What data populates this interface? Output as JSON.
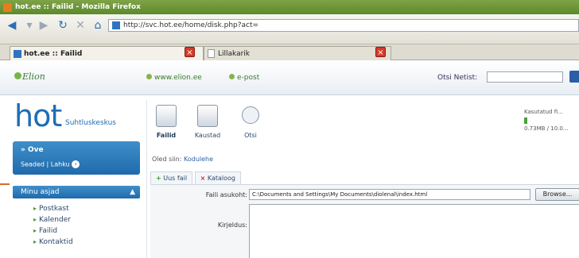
{
  "window": {
    "title": "hot.ee :: Failid - Mozilla Firefox"
  },
  "address_bar": {
    "url": "http://svc.hot.ee/home/disk.php?act="
  },
  "tabs": [
    {
      "label": "hot.ee :: Failid"
    },
    {
      "label": "Lillakarik"
    }
  ],
  "site_header": {
    "logo": "Elion",
    "links": [
      "www.elion.ee",
      "e-post"
    ],
    "search_label": "Otsi Netist:"
  },
  "sidebar": {
    "logo": "hot",
    "logo_sub": "Suhtluskeskus",
    "user_name": "Ove",
    "user_links": "Seaded | Lahku",
    "menu_title": "Minu asjad",
    "menu_items": [
      "Postkast",
      "Kalender",
      "Failid",
      "Kontaktid"
    ]
  },
  "toolbar": {
    "items": [
      "Failid",
      "Kaustad",
      "Otsi"
    ],
    "usage_line1": "Kasutatud fi...",
    "usage_line2": "0.73MB / 10.0..."
  },
  "breadcrumb": {
    "prefix": "Oled siin:",
    "current": "Kodulehe"
  },
  "subtabs": {
    "add_file": "Uus fail",
    "delete_folder": "Kataloog"
  },
  "form": {
    "file_label": "Faili asukoht:",
    "file_value": "C:\\Documents and Settings\\My Documents\\diolenal\\index.html",
    "browse_label": "Browse...",
    "desc_label": "Kirjeldus:"
  }
}
